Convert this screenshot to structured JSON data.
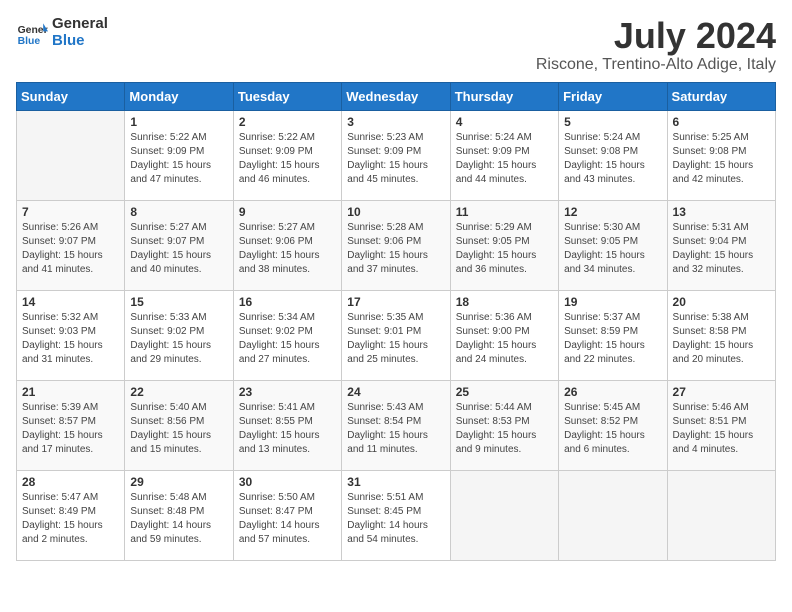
{
  "header": {
    "logo_general": "General",
    "logo_blue": "Blue",
    "month_title": "July 2024",
    "location": "Riscone, Trentino-Alto Adige, Italy"
  },
  "weekdays": [
    "Sunday",
    "Monday",
    "Tuesday",
    "Wednesday",
    "Thursday",
    "Friday",
    "Saturday"
  ],
  "weeks": [
    [
      {
        "day": "",
        "sunrise": "",
        "sunset": "",
        "daylight": ""
      },
      {
        "day": "1",
        "sunrise": "5:22 AM",
        "sunset": "9:09 PM",
        "daylight": "15 hours and 47 minutes."
      },
      {
        "day": "2",
        "sunrise": "5:22 AM",
        "sunset": "9:09 PM",
        "daylight": "15 hours and 46 minutes."
      },
      {
        "day": "3",
        "sunrise": "5:23 AM",
        "sunset": "9:09 PM",
        "daylight": "15 hours and 45 minutes."
      },
      {
        "day": "4",
        "sunrise": "5:24 AM",
        "sunset": "9:09 PM",
        "daylight": "15 hours and 44 minutes."
      },
      {
        "day": "5",
        "sunrise": "5:24 AM",
        "sunset": "9:08 PM",
        "daylight": "15 hours and 43 minutes."
      },
      {
        "day": "6",
        "sunrise": "5:25 AM",
        "sunset": "9:08 PM",
        "daylight": "15 hours and 42 minutes."
      }
    ],
    [
      {
        "day": "7",
        "sunrise": "5:26 AM",
        "sunset": "9:07 PM",
        "daylight": "15 hours and 41 minutes."
      },
      {
        "day": "8",
        "sunrise": "5:27 AM",
        "sunset": "9:07 PM",
        "daylight": "15 hours and 40 minutes."
      },
      {
        "day": "9",
        "sunrise": "5:27 AM",
        "sunset": "9:06 PM",
        "daylight": "15 hours and 38 minutes."
      },
      {
        "day": "10",
        "sunrise": "5:28 AM",
        "sunset": "9:06 PM",
        "daylight": "15 hours and 37 minutes."
      },
      {
        "day": "11",
        "sunrise": "5:29 AM",
        "sunset": "9:05 PM",
        "daylight": "15 hours and 36 minutes."
      },
      {
        "day": "12",
        "sunrise": "5:30 AM",
        "sunset": "9:05 PM",
        "daylight": "15 hours and 34 minutes."
      },
      {
        "day": "13",
        "sunrise": "5:31 AM",
        "sunset": "9:04 PM",
        "daylight": "15 hours and 32 minutes."
      }
    ],
    [
      {
        "day": "14",
        "sunrise": "5:32 AM",
        "sunset": "9:03 PM",
        "daylight": "15 hours and 31 minutes."
      },
      {
        "day": "15",
        "sunrise": "5:33 AM",
        "sunset": "9:02 PM",
        "daylight": "15 hours and 29 minutes."
      },
      {
        "day": "16",
        "sunrise": "5:34 AM",
        "sunset": "9:02 PM",
        "daylight": "15 hours and 27 minutes."
      },
      {
        "day": "17",
        "sunrise": "5:35 AM",
        "sunset": "9:01 PM",
        "daylight": "15 hours and 25 minutes."
      },
      {
        "day": "18",
        "sunrise": "5:36 AM",
        "sunset": "9:00 PM",
        "daylight": "15 hours and 24 minutes."
      },
      {
        "day": "19",
        "sunrise": "5:37 AM",
        "sunset": "8:59 PM",
        "daylight": "15 hours and 22 minutes."
      },
      {
        "day": "20",
        "sunrise": "5:38 AM",
        "sunset": "8:58 PM",
        "daylight": "15 hours and 20 minutes."
      }
    ],
    [
      {
        "day": "21",
        "sunrise": "5:39 AM",
        "sunset": "8:57 PM",
        "daylight": "15 hours and 17 minutes."
      },
      {
        "day": "22",
        "sunrise": "5:40 AM",
        "sunset": "8:56 PM",
        "daylight": "15 hours and 15 minutes."
      },
      {
        "day": "23",
        "sunrise": "5:41 AM",
        "sunset": "8:55 PM",
        "daylight": "15 hours and 13 minutes."
      },
      {
        "day": "24",
        "sunrise": "5:43 AM",
        "sunset": "8:54 PM",
        "daylight": "15 hours and 11 minutes."
      },
      {
        "day": "25",
        "sunrise": "5:44 AM",
        "sunset": "8:53 PM",
        "daylight": "15 hours and 9 minutes."
      },
      {
        "day": "26",
        "sunrise": "5:45 AM",
        "sunset": "8:52 PM",
        "daylight": "15 hours and 6 minutes."
      },
      {
        "day": "27",
        "sunrise": "5:46 AM",
        "sunset": "8:51 PM",
        "daylight": "15 hours and 4 minutes."
      }
    ],
    [
      {
        "day": "28",
        "sunrise": "5:47 AM",
        "sunset": "8:49 PM",
        "daylight": "15 hours and 2 minutes."
      },
      {
        "day": "29",
        "sunrise": "5:48 AM",
        "sunset": "8:48 PM",
        "daylight": "14 hours and 59 minutes."
      },
      {
        "day": "30",
        "sunrise": "5:50 AM",
        "sunset": "8:47 PM",
        "daylight": "14 hours and 57 minutes."
      },
      {
        "day": "31",
        "sunrise": "5:51 AM",
        "sunset": "8:45 PM",
        "daylight": "14 hours and 54 minutes."
      },
      {
        "day": "",
        "sunrise": "",
        "sunset": "",
        "daylight": ""
      },
      {
        "day": "",
        "sunrise": "",
        "sunset": "",
        "daylight": ""
      },
      {
        "day": "",
        "sunrise": "",
        "sunset": "",
        "daylight": ""
      }
    ]
  ],
  "labels": {
    "sunrise_prefix": "Sunrise: ",
    "sunset_prefix": "Sunset: ",
    "daylight_prefix": "Daylight: "
  }
}
